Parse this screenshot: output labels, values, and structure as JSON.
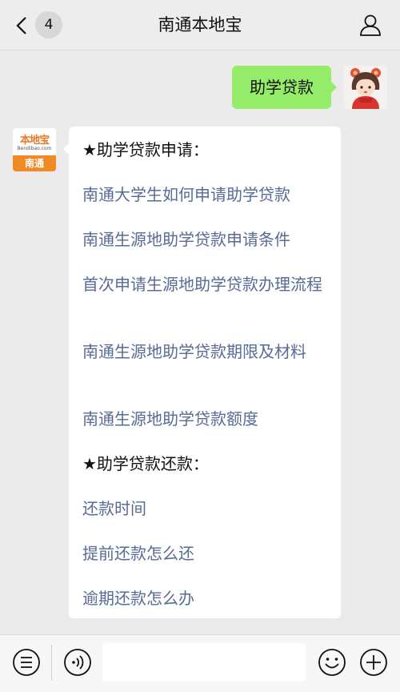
{
  "header": {
    "title": "南通本地宝",
    "unread_count": "4"
  },
  "user_message": {
    "text": "助学贷款"
  },
  "bot": {
    "avatar_logo": "本地宝",
    "avatar_subtext": "Bendibao.com",
    "avatar_city": "南通"
  },
  "bot_message": {
    "section1_heading": "★助学贷款申请：",
    "section1_links": [
      "南通大学生如何申请助学贷款",
      "南通生源地助学贷款申请条件",
      "首次申请生源地助学贷款办理流程",
      "南通生源地助学贷款期限及材料",
      "南通生源地助学贷款额度"
    ],
    "section2_heading": "★助学贷款还款：",
    "section2_links": [
      "还款时间",
      "提前还款怎么还",
      "逾期还款怎么办"
    ]
  },
  "footer": {
    "icons": [
      "menu-list-icon",
      "voice-icon",
      "emoji-icon",
      "plus-icon"
    ],
    "input_value": ""
  },
  "colors": {
    "user_bubble": "#95ec69",
    "link": "#576b95",
    "background": "#ebebeb",
    "avatar_orange": "#f08a24"
  }
}
